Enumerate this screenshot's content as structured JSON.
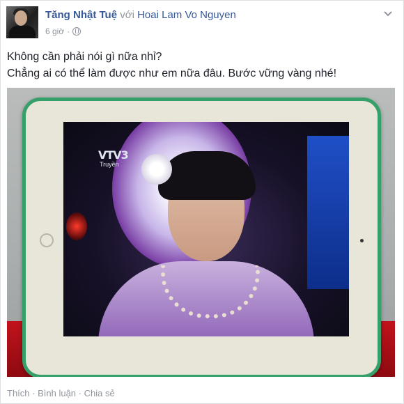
{
  "post": {
    "author": "Tăng Nhật Tuệ",
    "with_word": "với",
    "tagged": "Hoai Lam Vo Nguyen",
    "time": "6 giờ",
    "separator": "·",
    "privacy_icon": "globe-icon",
    "menu_icon": "chevron-down-icon",
    "text_lines": [
      "Không cần phải nói gì nữa nhỉ?",
      "Chẳng ai có thể làm được như em nữa đâu. Bước vững vàng nhé!"
    ]
  },
  "photo": {
    "tv_logo": "VTV3",
    "tv_logo_sub": "Truyền"
  },
  "actions": {
    "like": "Thích",
    "comment": "Bình luận",
    "share": "Chia sẻ",
    "separator": "·"
  },
  "colors": {
    "link": "#365899",
    "meta": "#90949c",
    "text": "#1d2129",
    "tablet_case": "#36a06a"
  }
}
